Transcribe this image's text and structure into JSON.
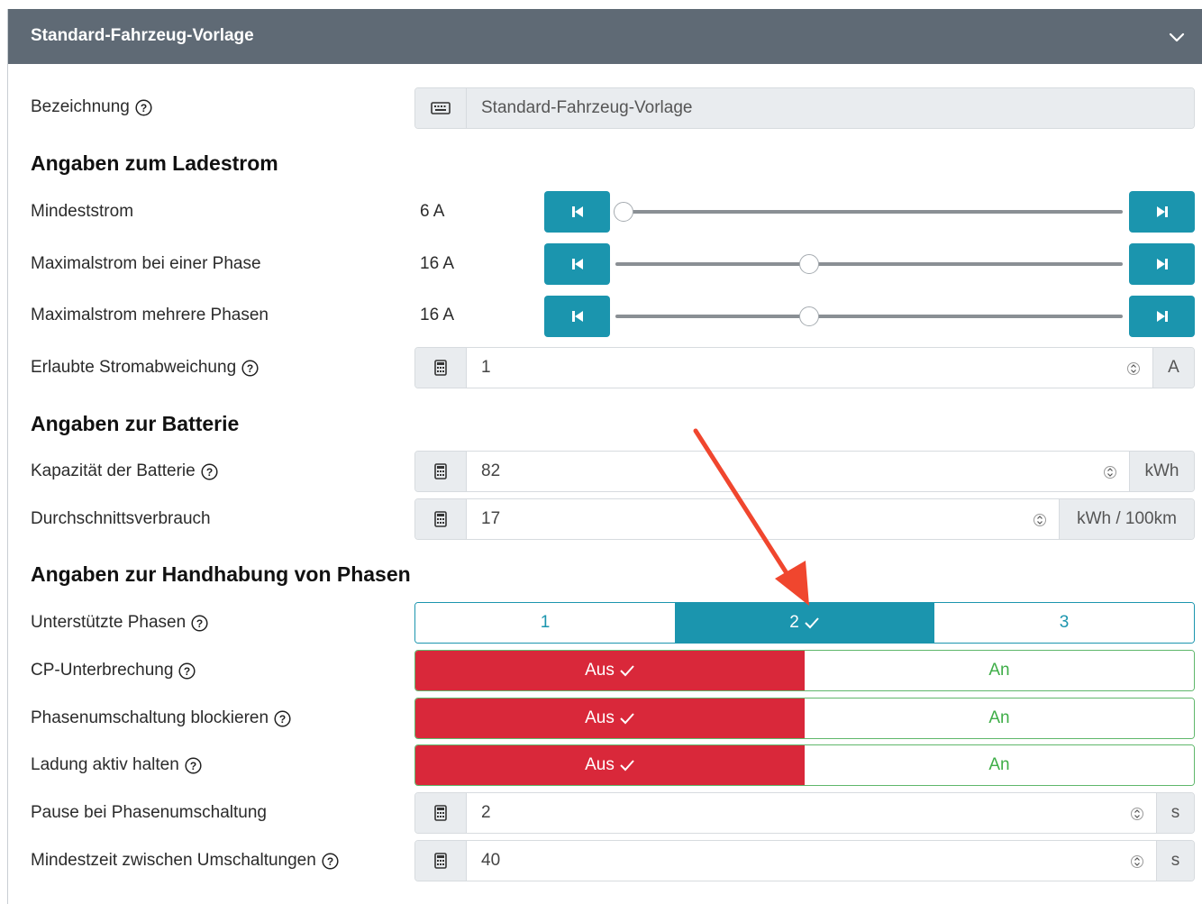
{
  "card": {
    "title": "Standard-Fahrzeug-Vorlage",
    "collapse_icon": "chevron-down-icon"
  },
  "bezeichnung": {
    "label": "Bezeichnung",
    "value": "Standard-Fahrzeug-Vorlage",
    "icon": "keyboard-icon"
  },
  "section_ladestrom": "Angaben zum Ladestrom",
  "mindeststrom": {
    "label": "Mindeststrom",
    "value": "6 A",
    "level": 0.0
  },
  "max_eine_phase": {
    "label": "Maximalstrom bei einer Phase",
    "value": "16 A",
    "level": 0.38
  },
  "max_mehrere_phasen": {
    "label": "Maximalstrom mehrere Phasen",
    "value": "16 A",
    "level": 0.38
  },
  "stromabweichung": {
    "label": "Erlaubte Stromabweichung",
    "value": "1",
    "unit": "A"
  },
  "section_batterie": "Angaben zur Batterie",
  "kapazitaet": {
    "label": "Kapazität der Batterie",
    "value": "82",
    "unit": "kWh"
  },
  "verbrauch": {
    "label": "Durchschnittsverbrauch",
    "value": "17",
    "unit": "kWh / 100km"
  },
  "section_phasen": "Angaben zur Handhabung von Phasen",
  "unterstuetzte_phasen": {
    "label": "Unterstützte Phasen",
    "options": [
      "1",
      "2",
      "3"
    ],
    "selected": "2"
  },
  "cp_unterbrechung": {
    "label": "CP-Unterbrechung",
    "off": "Aus",
    "on": "An",
    "selected": "Aus"
  },
  "phasenumschaltung_blockieren": {
    "label": "Phasenumschaltung blockieren",
    "off": "Aus",
    "on": "An",
    "selected": "Aus"
  },
  "ladung_aktiv": {
    "label": "Ladung aktiv halten",
    "off": "Aus",
    "on": "An",
    "selected": "Aus"
  },
  "pause": {
    "label": "Pause bei Phasenumschaltung",
    "value": "2",
    "unit": "s"
  },
  "mindestzeit": {
    "label": "Mindestzeit zwischen Umschaltungen",
    "value": "40",
    "unit": "s"
  },
  "colors": {
    "header_bg": "#5f6a75",
    "accent": "#1b95ae",
    "danger": "#d9283a",
    "success": "#3fae48",
    "annotation_arrow": "#f0462e"
  }
}
